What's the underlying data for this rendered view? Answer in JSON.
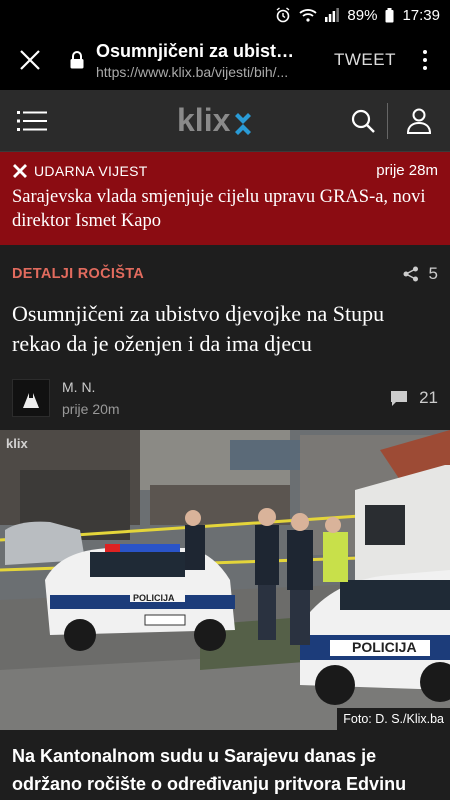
{
  "status_bar": {
    "battery": "89%",
    "time": "17:39"
  },
  "browser": {
    "title": "Osumnjičeni za ubistvo...",
    "url": "https://www.klix.ba/vijesti/bih/...",
    "tweet_label": "TWEET"
  },
  "site": {
    "logo": "klix"
  },
  "breaking": {
    "label": "UDARNA VIJEST",
    "time": "prije 28m",
    "headline": "Sarajevska vlada smjenjuje cijelu upravu GRAS-a, novi direktor Ismet Kapo"
  },
  "article": {
    "category": "DETALJI ROČIŠTA",
    "shares": "5",
    "title": "Osumnjičeni za ubistvo djevojke na Stupu rekao da je oženjen i da ima djecu",
    "author": "M. N.",
    "time_ago": "prije 20m",
    "comments": "21",
    "photo_credit": "Foto: D. S./Klix.ba",
    "photo_watermark": "klix",
    "police_label": "POLICIJA",
    "lead": "Na Kantonalnom sudu u Sarajevu danas je održano ročište o određivanju pritvora Edvinu"
  },
  "colors": {
    "breaking_bg": "#8b0c12",
    "category": "#e26b5e",
    "header_bg": "#2b2b2b",
    "page_bg": "#1e1e1e"
  }
}
